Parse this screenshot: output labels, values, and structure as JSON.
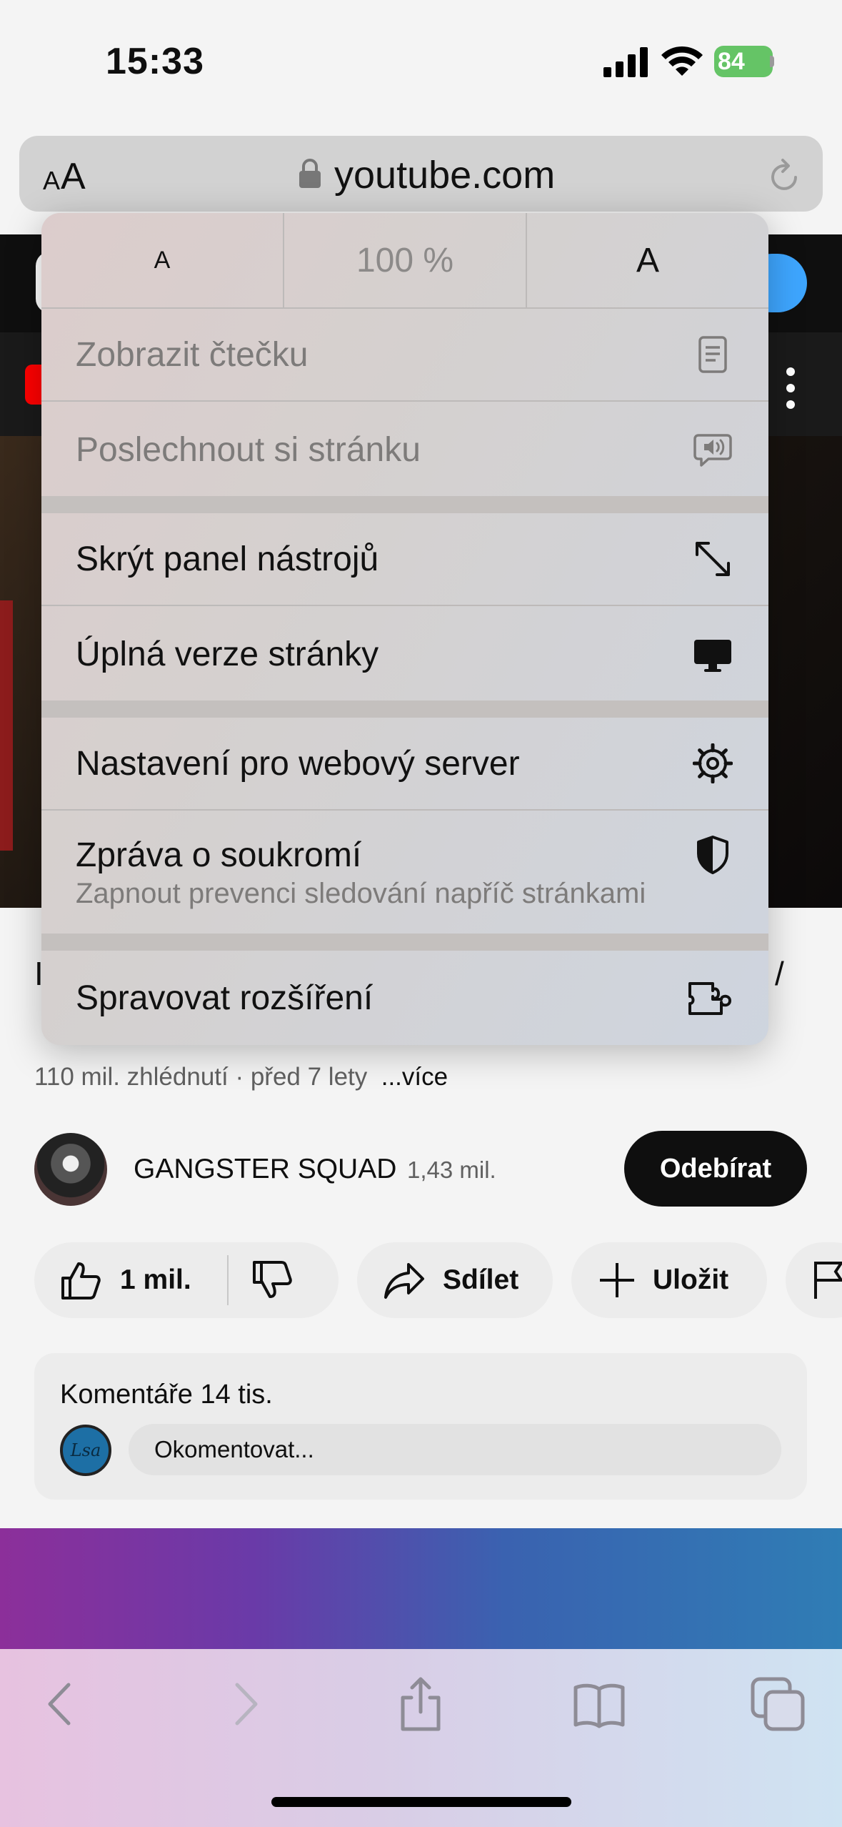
{
  "status_bar": {
    "time": "15:33",
    "battery": "84"
  },
  "address_bar": {
    "text_size_small": "A",
    "text_size_large": "A",
    "url": "youtube.com"
  },
  "menu": {
    "zoom": {
      "decrease": "A",
      "level": "100 %",
      "increase": "A"
    },
    "items": [
      {
        "label": "Zobrazit čtečku",
        "icon": "reader-icon",
        "enabled": false
      },
      {
        "label": "Poslechnout si stránku",
        "icon": "speaker-bubble-icon",
        "enabled": false
      },
      {
        "label": "Skrýt panel nástrojů",
        "icon": "resize-arrows-icon",
        "enabled": true
      },
      {
        "label": "Úplná verze stránky",
        "icon": "desktop-icon",
        "enabled": true
      },
      {
        "label": "Nastavení pro webový server",
        "icon": "gear-icon",
        "enabled": true
      },
      {
        "label": "Zpráva o soukromí",
        "sub": "Zapnout prevenci sledování napříč stránkami",
        "icon": "shield-icon",
        "enabled": true
      },
      {
        "label": "Spravovat rozšíření",
        "icon": "extension-icon",
        "enabled": true
      }
    ]
  },
  "page": {
    "title_left_fragment": "I",
    "title_right_fragment": "/",
    "views": "110 mil. zhlédnutí · před 7 lety",
    "more": "...více",
    "channel_name": "GANGSTER SQUAD",
    "subscribers": "1,43 mil.",
    "subscribe_label": "Odebírat",
    "likes": "1 mil.",
    "share_label": "Sdílet",
    "save_label": "Uložit",
    "comments_title": "Komentáře 14 tis.",
    "comment_avatar_text": "Lsa",
    "comment_placeholder": "Okomentovat..."
  },
  "toolbar": [
    "back-icon",
    "forward-icon",
    "share-icon",
    "bookmarks-icon",
    "tabs-icon"
  ]
}
